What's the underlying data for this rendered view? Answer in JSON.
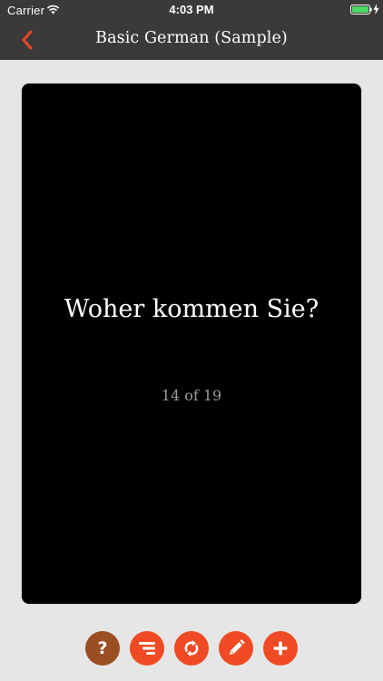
{
  "status_bar": {
    "carrier": "Carrier",
    "time": "4:03 PM",
    "battery_color": "#4cd964"
  },
  "nav": {
    "title": "Basic German (Sample)",
    "back_icon": "chevron-left-icon",
    "accent": "#e8472c"
  },
  "card": {
    "question": "Woher kommen Sie?",
    "progress": "14 of 19",
    "background": "#000000"
  },
  "toolbar": {
    "buttons": [
      {
        "name": "help",
        "icon": "question-mark-icon",
        "label": "?",
        "color": "#9a4f22"
      },
      {
        "name": "sort",
        "icon": "filter-sort-icon",
        "color": "#f04a24"
      },
      {
        "name": "flip",
        "icon": "refresh-flip-icon",
        "color": "#f04a24"
      },
      {
        "name": "edit",
        "icon": "pencil-icon",
        "color": "#f04a24"
      },
      {
        "name": "add",
        "icon": "plus-icon",
        "color": "#f04a24"
      }
    ]
  }
}
